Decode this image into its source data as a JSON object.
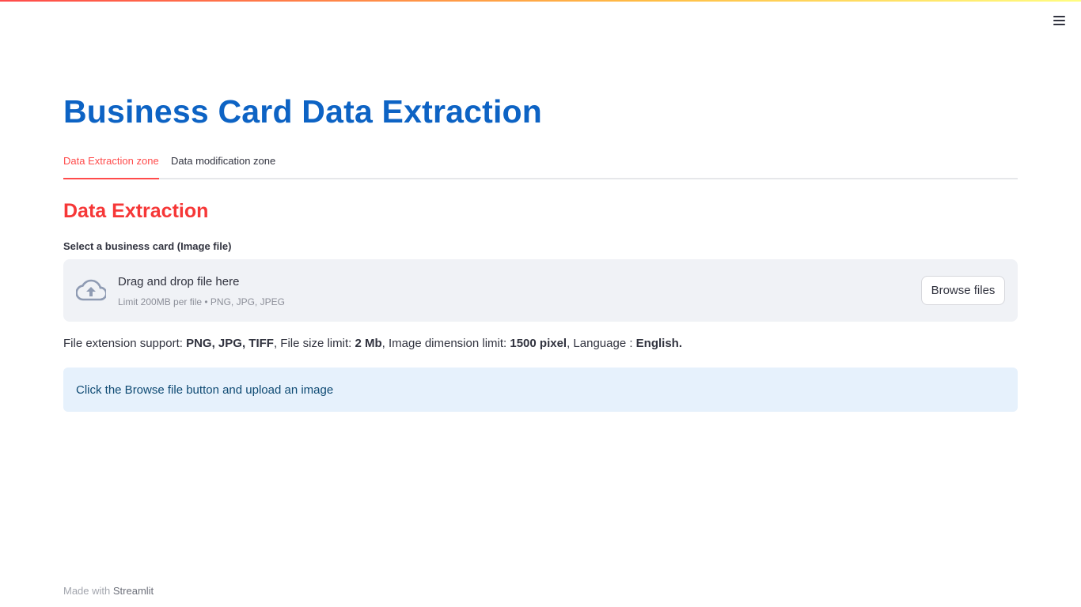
{
  "app": {
    "title": "Business Card Data Extraction",
    "menu_icon": "hamburger-menu-icon"
  },
  "tabs": [
    {
      "label": "Data Extraction zone",
      "active": true
    },
    {
      "label": "Data modification zone",
      "active": false
    }
  ],
  "section": {
    "title": "Data Extraction"
  },
  "uploader": {
    "label": "Select a business card (Image file)",
    "drop_text": "Drag and drop file here",
    "limit_text": "Limit 200MB per file • PNG, JPG, JPEG",
    "browse_label": "Browse files",
    "icon": "cloud-upload-icon"
  },
  "support": {
    "prefix1": "File extension support: ",
    "ext": "PNG, JPG, TIFF",
    "prefix2": ", File size limit: ",
    "size": "2 Mb",
    "prefix3": ", Image dimension limit: ",
    "dimension": "1500 pixel",
    "prefix4": ", Language : ",
    "language": "English."
  },
  "info": {
    "text": "Click the Browse file button and upload an image"
  },
  "footer": {
    "prefix": "Made with ",
    "link": "Streamlit"
  },
  "colors": {
    "title": "#0d63c4",
    "accent": "#ff4b4b",
    "section_title": "#f63737",
    "info_bg": "#e6f1fc",
    "dropzone_bg": "#f0f2f6"
  }
}
